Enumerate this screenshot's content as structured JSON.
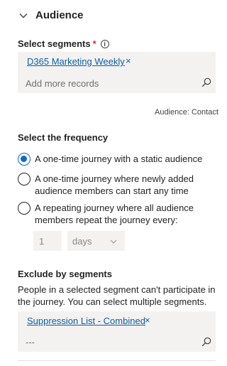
{
  "section": {
    "title": "Audience"
  },
  "segments": {
    "label": "Select segments",
    "required": "*",
    "info": "i",
    "selected": [
      {
        "label": "D365 Marketing Weekly",
        "remove": "×"
      }
    ],
    "placeholder": "Add more records",
    "audience_note": "Audience: Contact"
  },
  "frequency": {
    "label": "Select the frequency",
    "options": [
      {
        "line1": "A one-time journey with a static audience",
        "line2": "",
        "selected": true
      },
      {
        "line1": "A one-time journey where newly added",
        "line2": "audience members can start any time",
        "selected": false
      },
      {
        "line1": "A repeating journey where all audience",
        "line2": "members repeat the journey every:",
        "selected": false
      }
    ],
    "repeat_count": "1",
    "repeat_unit": "days"
  },
  "exclude": {
    "label": "Exclude by segments",
    "desc_line1": "People in a selected segment can't participate in",
    "desc_line2": "the journey. You can select multiple segments.",
    "selected": [
      {
        "label": "Suppression List - Combined",
        "remove": "×"
      }
    ],
    "placeholder": "---"
  },
  "icons": {
    "collapse": "chevron-down-icon",
    "search": "search-icon",
    "dropdown": "chevron-down-icon"
  },
  "colors": {
    "accent": "#0f6cbd",
    "link": "#115ea3",
    "field_bg": "#f3f2f1"
  }
}
